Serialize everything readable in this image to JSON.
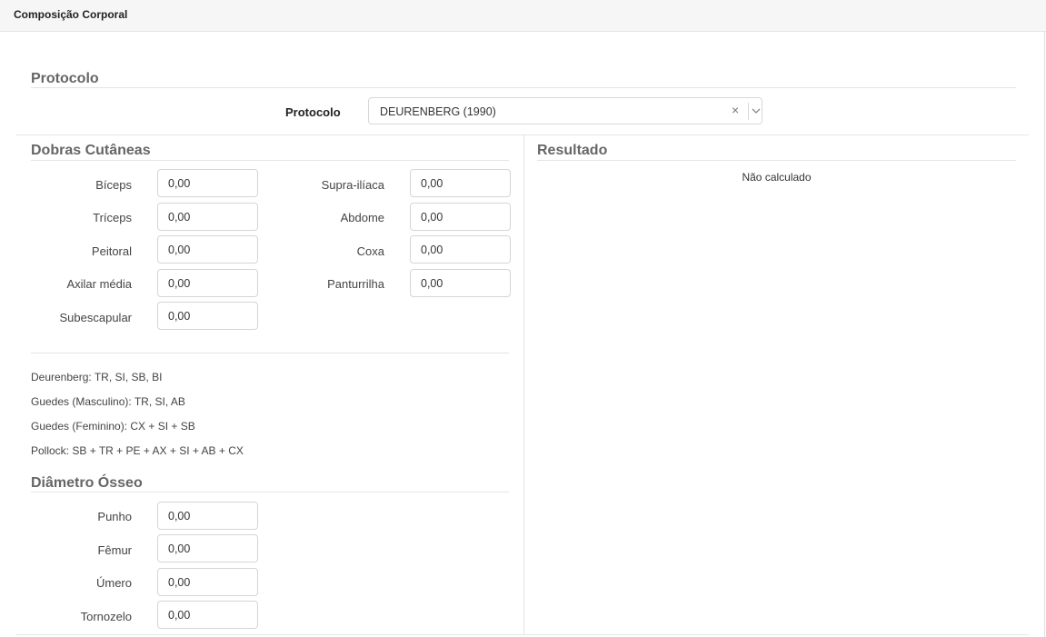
{
  "header": {
    "title": "Composição Corporal"
  },
  "protocolo": {
    "section_title": "Protocolo",
    "label": "Protocolo",
    "selected": "DEURENBERG (1990)",
    "clear_symbol": "×"
  },
  "dobras": {
    "section_title": "Dobras Cutâneas",
    "fields": [
      {
        "label": "Bíceps",
        "value": "0,00"
      },
      {
        "label": "Tríceps",
        "value": "0,00"
      },
      {
        "label": "Peitoral",
        "value": "0,00"
      },
      {
        "label": "Axilar média",
        "value": "0,00"
      },
      {
        "label": "Subescapular",
        "value": "0,00"
      },
      {
        "label": "Supra-ilíaca",
        "value": "0,00"
      },
      {
        "label": "Abdome",
        "value": "0,00"
      },
      {
        "label": "Coxa",
        "value": "0,00"
      },
      {
        "label": "Panturrilha",
        "value": "0,00"
      }
    ],
    "formulas": [
      "Deurenberg: TR, SI, SB, BI",
      "Guedes (Masculino): TR, SI, AB",
      "Guedes (Feminino): CX + SI + SB",
      "Pollock: SB + TR + PE + AX + SI + AB + CX"
    ]
  },
  "diametro": {
    "section_title": "Diâmetro Ósseo",
    "fields": [
      {
        "label": "Punho",
        "value": "0,00"
      },
      {
        "label": "Fêmur",
        "value": "0,00"
      },
      {
        "label": "Úmero",
        "value": "0,00"
      },
      {
        "label": "Tornozelo",
        "value": "0,00"
      }
    ]
  },
  "resultado": {
    "section_title": "Resultado",
    "text": "Não calculado"
  }
}
